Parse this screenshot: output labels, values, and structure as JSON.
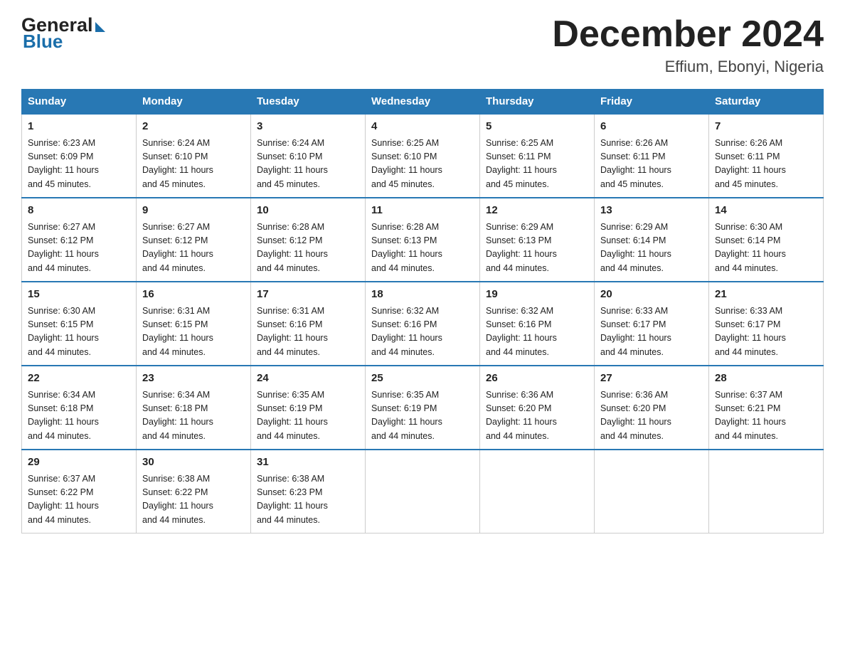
{
  "header": {
    "logo_general": "General",
    "logo_blue": "Blue",
    "month_title": "December 2024",
    "location": "Effium, Ebonyi, Nigeria"
  },
  "days_of_week": [
    "Sunday",
    "Monday",
    "Tuesday",
    "Wednesday",
    "Thursday",
    "Friday",
    "Saturday"
  ],
  "weeks": [
    [
      {
        "day": "1",
        "sunrise": "6:23 AM",
        "sunset": "6:09 PM",
        "daylight": "11 hours and 45 minutes."
      },
      {
        "day": "2",
        "sunrise": "6:24 AM",
        "sunset": "6:10 PM",
        "daylight": "11 hours and 45 minutes."
      },
      {
        "day": "3",
        "sunrise": "6:24 AM",
        "sunset": "6:10 PM",
        "daylight": "11 hours and 45 minutes."
      },
      {
        "day": "4",
        "sunrise": "6:25 AM",
        "sunset": "6:10 PM",
        "daylight": "11 hours and 45 minutes."
      },
      {
        "day": "5",
        "sunrise": "6:25 AM",
        "sunset": "6:11 PM",
        "daylight": "11 hours and 45 minutes."
      },
      {
        "day": "6",
        "sunrise": "6:26 AM",
        "sunset": "6:11 PM",
        "daylight": "11 hours and 45 minutes."
      },
      {
        "day": "7",
        "sunrise": "6:26 AM",
        "sunset": "6:11 PM",
        "daylight": "11 hours and 45 minutes."
      }
    ],
    [
      {
        "day": "8",
        "sunrise": "6:27 AM",
        "sunset": "6:12 PM",
        "daylight": "11 hours and 44 minutes."
      },
      {
        "day": "9",
        "sunrise": "6:27 AM",
        "sunset": "6:12 PM",
        "daylight": "11 hours and 44 minutes."
      },
      {
        "day": "10",
        "sunrise": "6:28 AM",
        "sunset": "6:12 PM",
        "daylight": "11 hours and 44 minutes."
      },
      {
        "day": "11",
        "sunrise": "6:28 AM",
        "sunset": "6:13 PM",
        "daylight": "11 hours and 44 minutes."
      },
      {
        "day": "12",
        "sunrise": "6:29 AM",
        "sunset": "6:13 PM",
        "daylight": "11 hours and 44 minutes."
      },
      {
        "day": "13",
        "sunrise": "6:29 AM",
        "sunset": "6:14 PM",
        "daylight": "11 hours and 44 minutes."
      },
      {
        "day": "14",
        "sunrise": "6:30 AM",
        "sunset": "6:14 PM",
        "daylight": "11 hours and 44 minutes."
      }
    ],
    [
      {
        "day": "15",
        "sunrise": "6:30 AM",
        "sunset": "6:15 PM",
        "daylight": "11 hours and 44 minutes."
      },
      {
        "day": "16",
        "sunrise": "6:31 AM",
        "sunset": "6:15 PM",
        "daylight": "11 hours and 44 minutes."
      },
      {
        "day": "17",
        "sunrise": "6:31 AM",
        "sunset": "6:16 PM",
        "daylight": "11 hours and 44 minutes."
      },
      {
        "day": "18",
        "sunrise": "6:32 AM",
        "sunset": "6:16 PM",
        "daylight": "11 hours and 44 minutes."
      },
      {
        "day": "19",
        "sunrise": "6:32 AM",
        "sunset": "6:16 PM",
        "daylight": "11 hours and 44 minutes."
      },
      {
        "day": "20",
        "sunrise": "6:33 AM",
        "sunset": "6:17 PM",
        "daylight": "11 hours and 44 minutes."
      },
      {
        "day": "21",
        "sunrise": "6:33 AM",
        "sunset": "6:17 PM",
        "daylight": "11 hours and 44 minutes."
      }
    ],
    [
      {
        "day": "22",
        "sunrise": "6:34 AM",
        "sunset": "6:18 PM",
        "daylight": "11 hours and 44 minutes."
      },
      {
        "day": "23",
        "sunrise": "6:34 AM",
        "sunset": "6:18 PM",
        "daylight": "11 hours and 44 minutes."
      },
      {
        "day": "24",
        "sunrise": "6:35 AM",
        "sunset": "6:19 PM",
        "daylight": "11 hours and 44 minutes."
      },
      {
        "day": "25",
        "sunrise": "6:35 AM",
        "sunset": "6:19 PM",
        "daylight": "11 hours and 44 minutes."
      },
      {
        "day": "26",
        "sunrise": "6:36 AM",
        "sunset": "6:20 PM",
        "daylight": "11 hours and 44 minutes."
      },
      {
        "day": "27",
        "sunrise": "6:36 AM",
        "sunset": "6:20 PM",
        "daylight": "11 hours and 44 minutes."
      },
      {
        "day": "28",
        "sunrise": "6:37 AM",
        "sunset": "6:21 PM",
        "daylight": "11 hours and 44 minutes."
      }
    ],
    [
      {
        "day": "29",
        "sunrise": "6:37 AM",
        "sunset": "6:22 PM",
        "daylight": "11 hours and 44 minutes."
      },
      {
        "day": "30",
        "sunrise": "6:38 AM",
        "sunset": "6:22 PM",
        "daylight": "11 hours and 44 minutes."
      },
      {
        "day": "31",
        "sunrise": "6:38 AM",
        "sunset": "6:23 PM",
        "daylight": "11 hours and 44 minutes."
      },
      null,
      null,
      null,
      null
    ]
  ],
  "labels": {
    "sunrise": "Sunrise:",
    "sunset": "Sunset:",
    "daylight": "Daylight:"
  }
}
